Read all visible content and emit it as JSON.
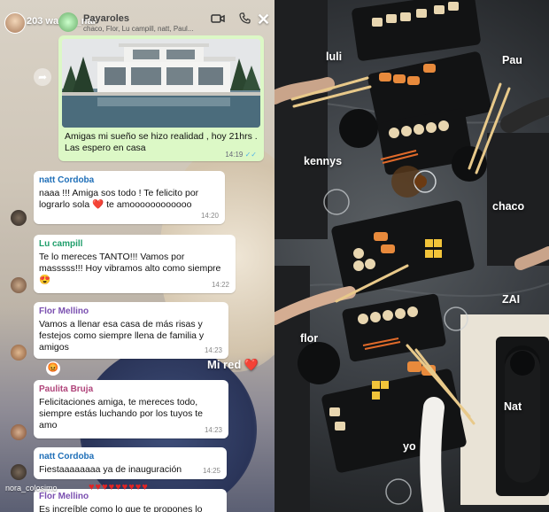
{
  "story": {
    "header": {
      "username": "203",
      "handle_overlay": "wanda_nar",
      "group_name": "Payaroles",
      "members": "chaco, Flor, Lu campill, natt, Paul...",
      "icons": [
        "video-call-icon",
        "phone-icon",
        "close-icon"
      ]
    },
    "sent_message": {
      "text": "Amigas mi sueño se hizo realidad , hoy 21hrs . Las espero en casa",
      "time": "14:19"
    },
    "messages": [
      {
        "author": "natt Cordoba",
        "author_color": "#1f6fb8",
        "text": "naaa !!! Amiga sos todo ! Te felicito por lograrlo sola ❤️ te amoooooooooooo",
        "time": "14:20"
      },
      {
        "author": "Lu campill",
        "author_color": "#1f9e6b",
        "text": "Te lo mereces TANTO!!! Vamos por masssss!!! Hoy vibramos alto como siempre 😍",
        "time": "14:22"
      },
      {
        "author": "Flor Mellino",
        "author_color": "#7a4fb0",
        "text": "Vamos a llenar esa casa de más risas y festejos como siempre llena de familia y amigos",
        "time": "14:23"
      },
      {
        "author": "Paulita Bruja",
        "author_color": "#b0447a",
        "text": "Felicitaciones amiga, te mereces todo, siempre estás luchando por los tuyos te amo",
        "time": "14:23"
      },
      {
        "author": "natt Cordoba",
        "author_color": "#1f6fb8",
        "text": "Fiestaaaaaaaa ya de inauguración",
        "time": "14:25"
      },
      {
        "author": "Flor Mellino",
        "author_color": "#7a4fb0",
        "text": "Es increíble como lo que te propones lo",
        "time": ""
      }
    ],
    "reaction_emoji": "😡",
    "overlay_text": "Mi red",
    "overlay_heart": "❤️",
    "viewer_name": "nora_colosimo",
    "viewer_hearts": "♥♥♥♥♥♥♥♥♥"
  },
  "photo_labels": {
    "luli": "luli",
    "pau": "Pau",
    "kennys": "kennys",
    "chaco": "chaco",
    "zai": "ZAI",
    "flor": "flor",
    "nat": "Nat",
    "yo": "yo"
  },
  "colors": {
    "sent_bubble": "#dcf8c6",
    "received_bubble": "#ffffff",
    "heart": "#e02424"
  }
}
